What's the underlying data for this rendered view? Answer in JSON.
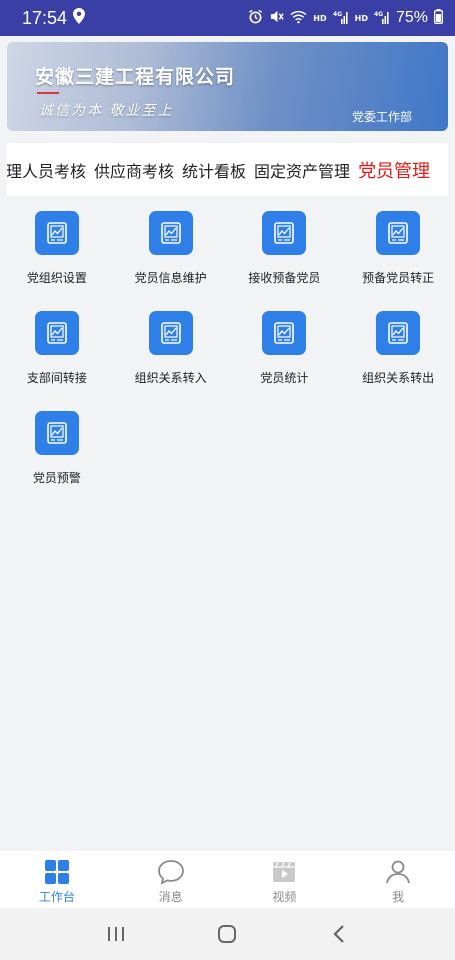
{
  "status_bar": {
    "time": "17:54",
    "hd1": "HD",
    "hd2": "HD",
    "net1": "4G",
    "net2": "4G",
    "battery": "75%"
  },
  "banner": {
    "company": "安徽三建工程有限公司",
    "slogan": "诚信为本  敬业至上",
    "department": "党委工作部"
  },
  "tabs": [
    {
      "label": "管理人员考核"
    },
    {
      "label": "供应商考核"
    },
    {
      "label": "统计看板"
    },
    {
      "label": "固定资产管理"
    },
    {
      "label": "党员管理",
      "active": true
    }
  ],
  "grid_items": [
    {
      "label": "党组织设置",
      "icon": "chart-doc-icon"
    },
    {
      "label": "党员信息维护",
      "icon": "chart-doc-icon"
    },
    {
      "label": "接收预备党员",
      "icon": "chart-doc-icon"
    },
    {
      "label": "预备党员转正",
      "icon": "chart-doc-icon"
    },
    {
      "label": "支部间转接",
      "icon": "chart-doc-icon"
    },
    {
      "label": "组织关系转入",
      "icon": "chart-doc-icon"
    },
    {
      "label": "党员统计",
      "icon": "chart-doc-icon"
    },
    {
      "label": "组织关系转出",
      "icon": "chart-doc-icon"
    },
    {
      "label": "党员预警",
      "icon": "chart-doc-icon"
    }
  ],
  "bottom_nav": [
    {
      "label": "工作台",
      "icon": "grid-icon",
      "active": true
    },
    {
      "label": "消息",
      "icon": "chat-bubble-icon"
    },
    {
      "label": "视频",
      "icon": "video-icon"
    },
    {
      "label": "我",
      "icon": "person-icon"
    }
  ],
  "colors": {
    "accent": "#2f7fe8",
    "active_tab": "#e21b1b",
    "status_bar": "#3a3fa6"
  }
}
